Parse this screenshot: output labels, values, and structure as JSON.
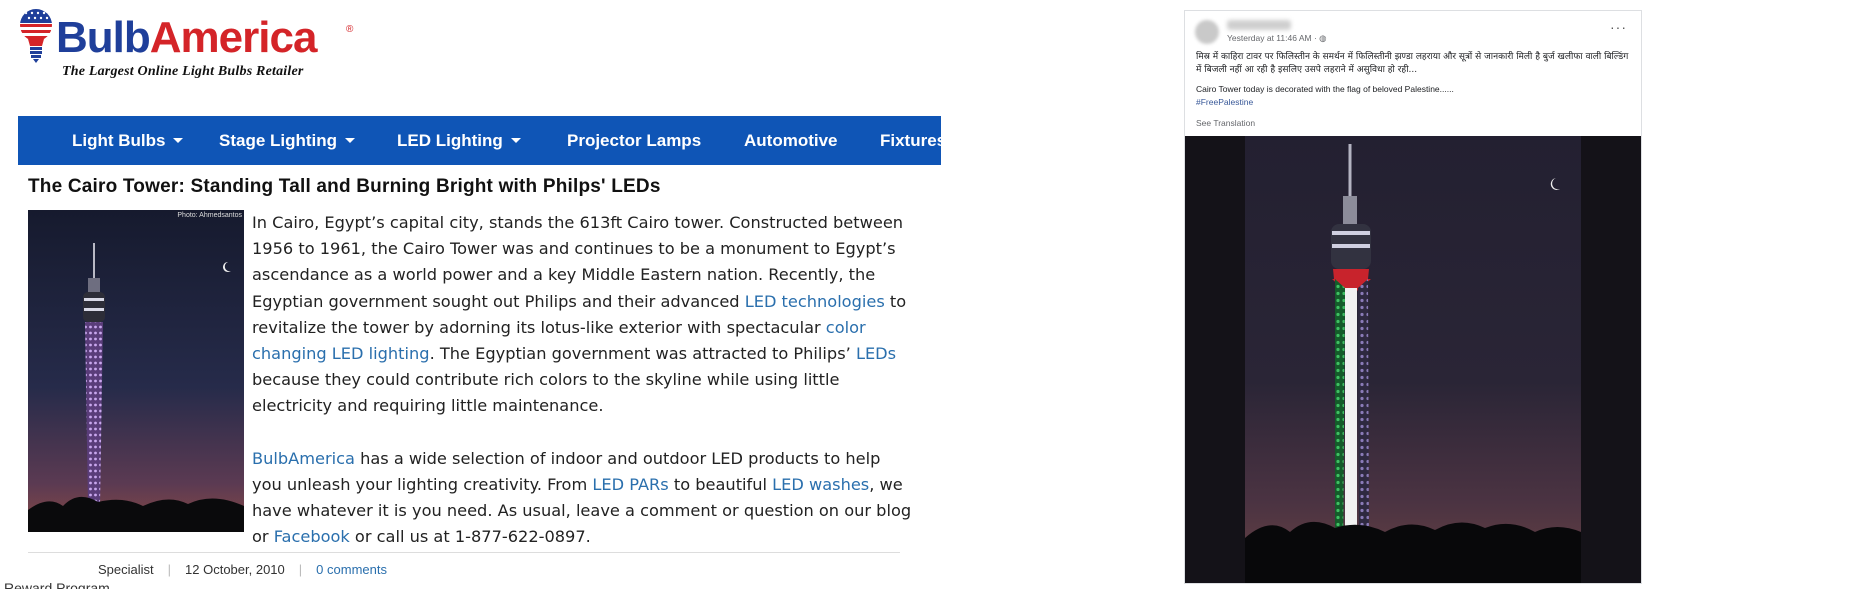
{
  "brand": {
    "name_part1": "Bulb",
    "name_part2": "America",
    "registered": "®",
    "tagline": "The Largest Online Light Bulbs Retailer",
    "colors": {
      "blue": "#1f3f9a",
      "red": "#d42428",
      "nav": "#0f55b6"
    }
  },
  "nav": {
    "items": [
      {
        "label": "Light Bulbs",
        "dropdown": true
      },
      {
        "label": "Stage Lighting",
        "dropdown": true
      },
      {
        "label": "LED Lighting",
        "dropdown": true
      },
      {
        "label": "Projector Lamps",
        "dropdown": false
      },
      {
        "label": "Automotive",
        "dropdown": false
      },
      {
        "label": "Fixtures",
        "dropdown": false
      }
    ]
  },
  "article": {
    "title": "The Cairo Tower: Standing Tall and Burning Bright with Philps' LEDs",
    "photo_credit": "Photo: Ahmedsantos",
    "p1": {
      "t1": "In Cairo, Egypt’s capital city, stands the 613ft Cairo tower. Constructed between 1956 to 1961, the Cairo Tower was and continues to be a monument to Egypt’s ascendance as a world power and a key Middle Eastern nation. Recently, the Egyptian government sought out Philips and their advanced ",
      "l1": "LED technologies",
      "t2": " to revitalize the tower by adorning its lotus-like exterior with spectacular ",
      "l2": "color changing LED lighting",
      "t3": ". The Egyptian government was attracted to Philips’ ",
      "l3": "LEDs",
      "t4": " because they could contribute rich colors to the skyline while using little electricity and requiring little maintenance."
    },
    "p2": {
      "l1": "BulbAmerica",
      "t1": " has a wide selection of indoor and outdoor LED products to help you unleash your lighting creativity. From ",
      "l2": "LED PARs",
      "t2": " to beautiful ",
      "l3": "LED washes",
      "t3": ", we have whatever it is you need. As usual, leave a comment or question on our blog or ",
      "l4": "Facebook",
      "t4": " or call us at 1-877-622-0897."
    },
    "meta": {
      "author": "Specialist",
      "date": "12 October, 2010",
      "comments": "0 comments"
    }
  },
  "footer": {
    "reward": "Reward Program"
  },
  "post": {
    "time": "Yesterday at 11:46 AM · ",
    "text_hindi": "मिस्र में काहिरा टावर पर फिलिस्तीन के समर्थन में फिलिस्तीनी झण्डा लहराया और सूत्रों से जानकारी मिली है बुर्ज खलीफा वाली बिल्डिंग में बिजली नहीं आ रही है इसलिए उसपे लहराने में असुविधा हो रही...",
    "text_en": "Cairo Tower today is decorated with the flag of beloved Palestine......",
    "hashtag": "#FreePalestine",
    "see_translation": "See Translation",
    "flag_colors": {
      "red": "#c8232c",
      "white": "#f4f4f4",
      "green": "#1c8a3c",
      "black": "#151515"
    }
  }
}
